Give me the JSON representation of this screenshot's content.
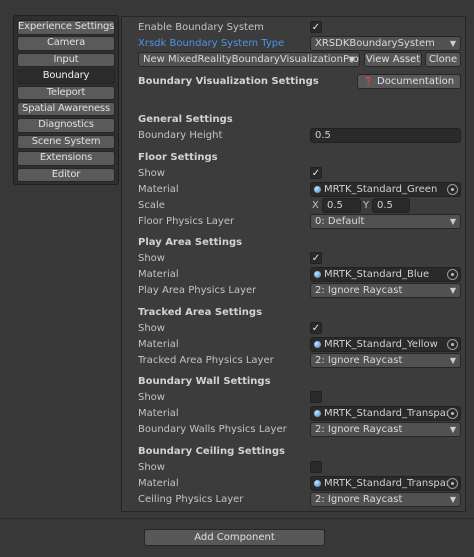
{
  "nav": {
    "items": [
      {
        "label": "Experience Settings",
        "active": false
      },
      {
        "label": "Camera",
        "active": false
      },
      {
        "label": "Input",
        "active": false
      },
      {
        "label": "Boundary",
        "active": true
      },
      {
        "label": "Teleport",
        "active": false
      },
      {
        "label": "Spatial Awareness",
        "active": false
      },
      {
        "label": "Diagnostics",
        "active": false
      },
      {
        "label": "Scene System",
        "active": false
      },
      {
        "label": "Extensions",
        "active": false
      },
      {
        "label": "Editor",
        "active": false
      }
    ]
  },
  "top": {
    "enable_label": "Enable Boundary System",
    "enable_checked": "✓",
    "type_label": "Xrsdk Boundary System Type",
    "type_value": "XRSDKBoundarySystem",
    "profile_value": "New MixedRealityBoundaryVisualizationProfile",
    "view_asset": "View Asset",
    "clone": "Clone"
  },
  "section_title": "Boundary Visualization Settings",
  "documentation": "Documentation",
  "general": {
    "title": "General Settings",
    "height_label": "Boundary Height",
    "height_value": "0.5"
  },
  "floor": {
    "title": "Floor Settings",
    "show_label": "Show",
    "show_checked": "✓",
    "material_label": "Material",
    "material_value": "MRTK_Standard_Green",
    "scale_label": "Scale",
    "scale_x_label": "X",
    "scale_x": "0.5",
    "scale_y_label": "Y",
    "scale_y": "0.5",
    "layer_label": "Floor Physics Layer",
    "layer_value": "0: Default"
  },
  "play_area": {
    "title": "Play Area Settings",
    "show_label": "Show",
    "show_checked": "✓",
    "material_label": "Material",
    "material_value": "MRTK_Standard_Blue",
    "layer_label": "Play Area Physics Layer",
    "layer_value": "2: Ignore Raycast"
  },
  "tracked_area": {
    "title": "Tracked Area Settings",
    "show_label": "Show",
    "show_checked": "✓",
    "material_label": "Material",
    "material_value": "MRTK_Standard_Yellow",
    "layer_label": "Tracked Area Physics Layer",
    "layer_value": "2: Ignore Raycast"
  },
  "wall": {
    "title": "Boundary Wall Settings",
    "show_label": "Show",
    "show_checked": "",
    "material_label": "Material",
    "material_value": "MRTK_Standard_Transpare",
    "layer_label": "Boundary Walls Physics Layer",
    "layer_value": "2: Ignore Raycast"
  },
  "ceiling": {
    "title": "Boundary Ceiling Settings",
    "show_label": "Show",
    "show_checked": "",
    "material_label": "Material",
    "material_value": "MRTK_Standard_Transpare",
    "layer_label": "Ceiling Physics Layer",
    "layer_value": "2: Ignore Raycast"
  },
  "add_component": "Add Component",
  "icons": {
    "dropdown": "dropdown-arrow-icon",
    "material": "material-sphere-icon",
    "object_picker": "object-picker-icon",
    "help": "help-icon"
  }
}
